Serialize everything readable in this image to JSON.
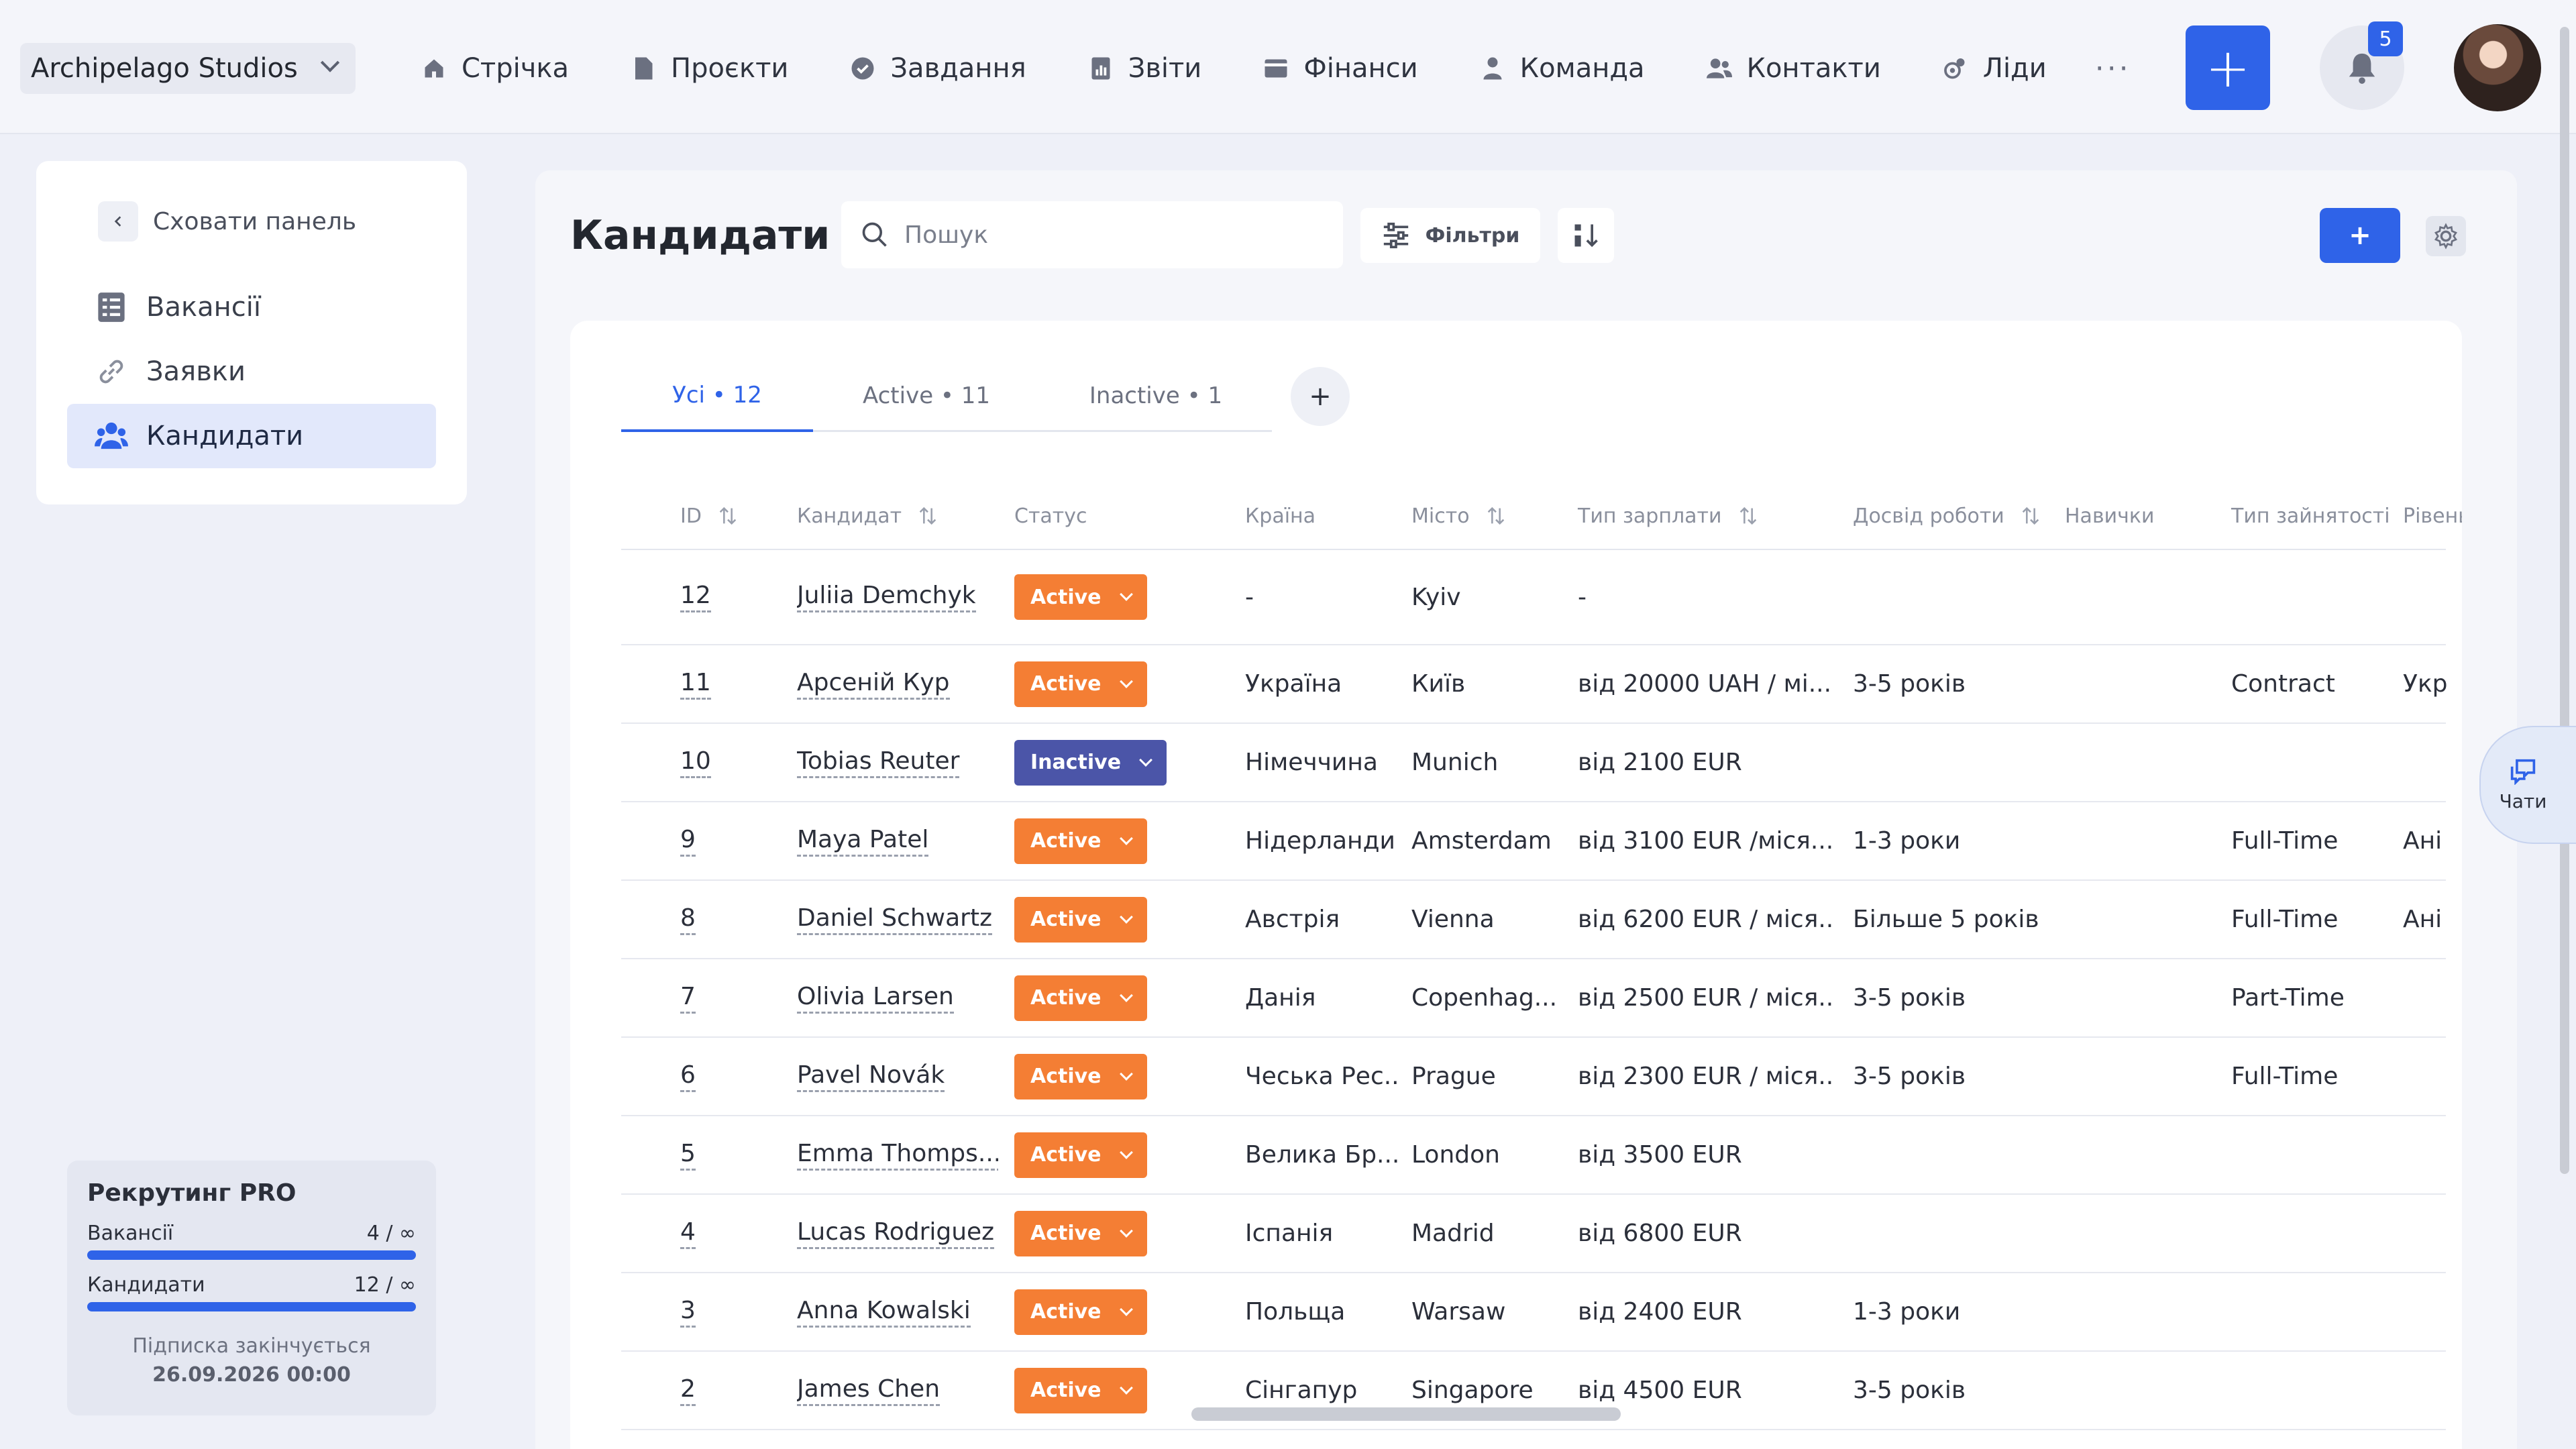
{
  "workspace": {
    "name": "Archipelago Studios"
  },
  "nav": {
    "items": [
      {
        "label": "Стрічка",
        "icon": "home-icon"
      },
      {
        "label": "Проєкти",
        "icon": "file-icon"
      },
      {
        "label": "Завдання",
        "icon": "check-circle-icon"
      },
      {
        "label": "Звіти",
        "icon": "report-icon"
      },
      {
        "label": "Фінанси",
        "icon": "wallet-icon"
      },
      {
        "label": "Команда",
        "icon": "user-icon"
      },
      {
        "label": "Контакти",
        "icon": "contacts-icon"
      },
      {
        "label": "Ліди",
        "icon": "leads-icon"
      }
    ],
    "more": "···",
    "add": "+",
    "notifications_count": "5"
  },
  "sidebar": {
    "hide_label": "Сховати панель",
    "items": [
      {
        "label": "Вакансії",
        "icon": "list-icon",
        "active": false
      },
      {
        "label": "Заявки",
        "icon": "link-icon",
        "active": false
      },
      {
        "label": "Кандидати",
        "icon": "users-icon",
        "active": true
      }
    ]
  },
  "plan": {
    "title": "Рекрутинг PRO",
    "vacancies_label": "Вакансії",
    "vacancies_value": "4 / ∞",
    "candidates_label": "Кандидати",
    "candidates_value": "12 / ∞",
    "expires_label": "Підписка закінчується",
    "expires_date": "26.09.2026 00:00"
  },
  "page": {
    "title": "Кандидати",
    "search_placeholder": "Пошук",
    "filters_label": "Фільтри",
    "add_label": "+"
  },
  "tabs": [
    {
      "label": "Усі • 12",
      "active": true
    },
    {
      "label": "Active • 11",
      "active": false
    },
    {
      "label": "Inactive • 1",
      "active": false
    }
  ],
  "tab_add": "+",
  "columns": [
    {
      "label": "ID",
      "sortable": true
    },
    {
      "label": "Кандидат",
      "sortable": true
    },
    {
      "label": "Статус",
      "sortable": false
    },
    {
      "label": "Країна",
      "sortable": false
    },
    {
      "label": "Місто",
      "sortable": true
    },
    {
      "label": "Тип зарплати",
      "sortable": true
    },
    {
      "label": "Досвід роботи",
      "sortable": true
    },
    {
      "label": "Навички",
      "sortable": false
    },
    {
      "label": "Тип зайнятості",
      "sortable": false
    },
    {
      "label": "Рівень",
      "sortable": false
    }
  ],
  "status_colors": {
    "Active": "#f47e34",
    "Inactive": "#4b55a8"
  },
  "rows": [
    {
      "id": "12",
      "name": "Juliia Demchyk",
      "status": "Active",
      "country": "-",
      "city": "Kyiv",
      "salary": "-",
      "experience": "",
      "skills": "",
      "employment": "",
      "level": ""
    },
    {
      "id": "11",
      "name": "Арсеній Кур",
      "status": "Active",
      "country": "Україна",
      "city": "Київ",
      "salary": "від 20000 UAH / мі...",
      "experience": "3-5 років",
      "skills": "",
      "employment": "Contract",
      "level": "Укр"
    },
    {
      "id": "10",
      "name": "Tobias Reuter",
      "status": "Inactive",
      "country": "Німеччина",
      "city": "Munich",
      "salary": "від 2100 EUR",
      "experience": "",
      "skills": "",
      "employment": "",
      "level": ""
    },
    {
      "id": "9",
      "name": "Maya Patel",
      "status": "Active",
      "country": "Нідерланди",
      "city": "Amsterdam",
      "salary": "від 3100 EUR /міся...",
      "experience": "1-3 роки",
      "skills": "",
      "employment": "Full-Time",
      "level": "Ані"
    },
    {
      "id": "8",
      "name": "Daniel Schwartz",
      "status": "Active",
      "country": "Австрія",
      "city": "Vienna",
      "salary": "від 6200 EUR / міся...",
      "experience": "Більше 5 років",
      "skills": "",
      "employment": "Full-Time",
      "level": "Ані"
    },
    {
      "id": "7",
      "name": "Olivia Larsen",
      "status": "Active",
      "country": "Данія",
      "city": "Copenhag...",
      "salary": "від 2500 EUR / міся...",
      "experience": "3-5 років",
      "skills": "",
      "employment": "Part-Time",
      "level": ""
    },
    {
      "id": "6",
      "name": "Pavel Novák",
      "status": "Active",
      "country": "Чеська Рес...",
      "city": "Prague",
      "salary": "від 2300 EUR / міся...",
      "experience": "3-5 років",
      "skills": "",
      "employment": "Full-Time",
      "level": ""
    },
    {
      "id": "5",
      "name": "Emma Thomps...",
      "status": "Active",
      "country": "Велика Бр...",
      "city": "London",
      "salary": "від 3500 EUR",
      "experience": "",
      "skills": "",
      "employment": "",
      "level": ""
    },
    {
      "id": "4",
      "name": "Lucas Rodriguez",
      "status": "Active",
      "country": "Іспанія",
      "city": "Madrid",
      "salary": "від 6800 EUR",
      "experience": "",
      "skills": "",
      "employment": "",
      "level": ""
    },
    {
      "id": "3",
      "name": "Anna Kowalski",
      "status": "Active",
      "country": "Польща",
      "city": "Warsaw",
      "salary": "від 2400 EUR",
      "experience": "1-3 роки",
      "skills": "",
      "employment": "",
      "level": ""
    },
    {
      "id": "2",
      "name": "James Chen",
      "status": "Active",
      "country": "Сінгапур",
      "city": "Singapore",
      "salary": "від 4500 EUR",
      "experience": "3-5 років",
      "skills": "",
      "employment": "",
      "level": ""
    }
  ],
  "chat": {
    "label": "Чати"
  }
}
